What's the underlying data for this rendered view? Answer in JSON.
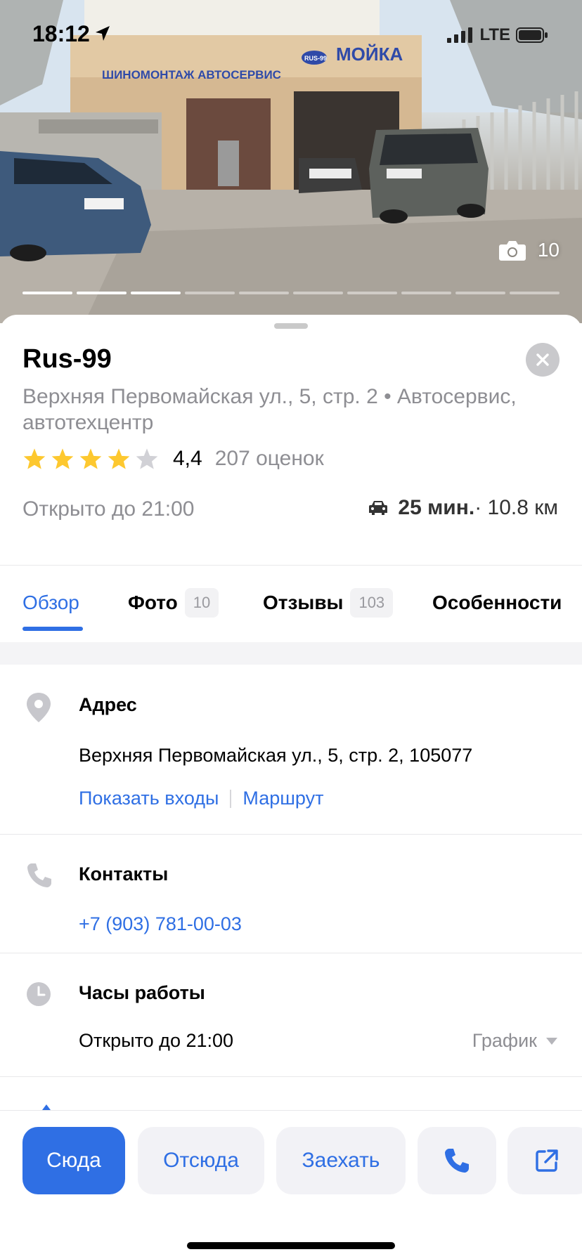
{
  "status_bar": {
    "time": "18:12",
    "network": "LTE",
    "location_icon": "location-arrow-icon",
    "signal_icon": "signal-bars-icon",
    "battery_icon": "battery-icon"
  },
  "photo": {
    "count": "10",
    "camera_icon": "camera-icon",
    "sign_text_left": "ШИНОМОНТАЖ АВТОСЕРВИС",
    "sign_logo": "RUS-99",
    "sign_text_right": "МОЙКА",
    "progress_total": 10,
    "progress_done": 3
  },
  "place": {
    "name": "Rus-99",
    "subtitle": "Верхняя Первомайская ул., 5, стр. 2 • Автосервис, автотехцентр",
    "rating_value": "4,4",
    "rating_stars": 4,
    "rating_count": "207 оценок",
    "open_until": "Открыто до 21:00",
    "route_time": "25 мин.",
    "route_distance": " · 10.8 км"
  },
  "tabs": [
    {
      "label": "Обзор",
      "badge": ""
    },
    {
      "label": "Фото",
      "badge": "10"
    },
    {
      "label": "Отзывы",
      "badge": "103"
    },
    {
      "label": "Особенности",
      "badge": ""
    }
  ],
  "address": {
    "title": "Адрес",
    "text": "Верхняя Первомайская ул., 5, стр. 2, 105077",
    "link_entrances": "Показать входы",
    "link_route": "Маршрут"
  },
  "contacts": {
    "title": "Контакты",
    "phone": "+7 (903) 781-00-03"
  },
  "hours": {
    "title": "Часы работы",
    "text": "Открыто до 21:00",
    "schedule_label": "График"
  },
  "actions": {
    "here": "Сюда",
    "from_here": "Отсюда",
    "stop_by": "Заехать",
    "call_icon": "phone-icon",
    "share_icon": "share-icon"
  },
  "colors": {
    "accent": "#2f6fe4",
    "star": "#fdc82f",
    "star_empty": "#d1d1d6",
    "muted_text": "#8e8e93"
  }
}
